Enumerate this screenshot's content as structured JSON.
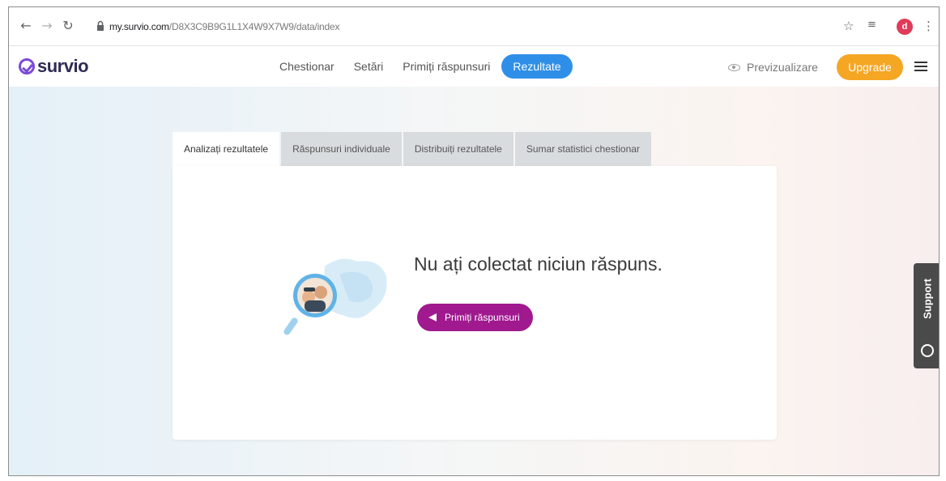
{
  "browser": {
    "url_host": "my.survio.com",
    "url_path": "/D8X3C9B9G1L1X4W9X7W9/data/index",
    "back_icon": "arrow-left-icon",
    "forward_icon": "arrow-right-icon",
    "reload_icon": "reload-icon",
    "star_icon": "star-icon",
    "profile_initial": "d"
  },
  "app": {
    "logo_text": "survio",
    "nav": [
      {
        "label": "Chestionar"
      },
      {
        "label": "Setări"
      },
      {
        "label": "Primiți răspunsuri"
      },
      {
        "label": "Rezultate"
      }
    ],
    "preview_label": "Previzualizare",
    "upgrade_label": "Upgrade"
  },
  "tabs": [
    {
      "label": "Analizați rezultatele"
    },
    {
      "label": "Răspunsuri individuale"
    },
    {
      "label": "Distribuiți rezultatele"
    },
    {
      "label": "Sumar statistici chestionar"
    }
  ],
  "empty_state": {
    "title": "Nu ați colectat niciun răspuns.",
    "button_label": "Primiți răspunsuri"
  },
  "support": {
    "label": "Support"
  },
  "colors": {
    "brand": "#7b4bd6",
    "active_nav": "#2f8fe8",
    "upgrade": "#f5a623",
    "collect_button": "#a0198f"
  }
}
